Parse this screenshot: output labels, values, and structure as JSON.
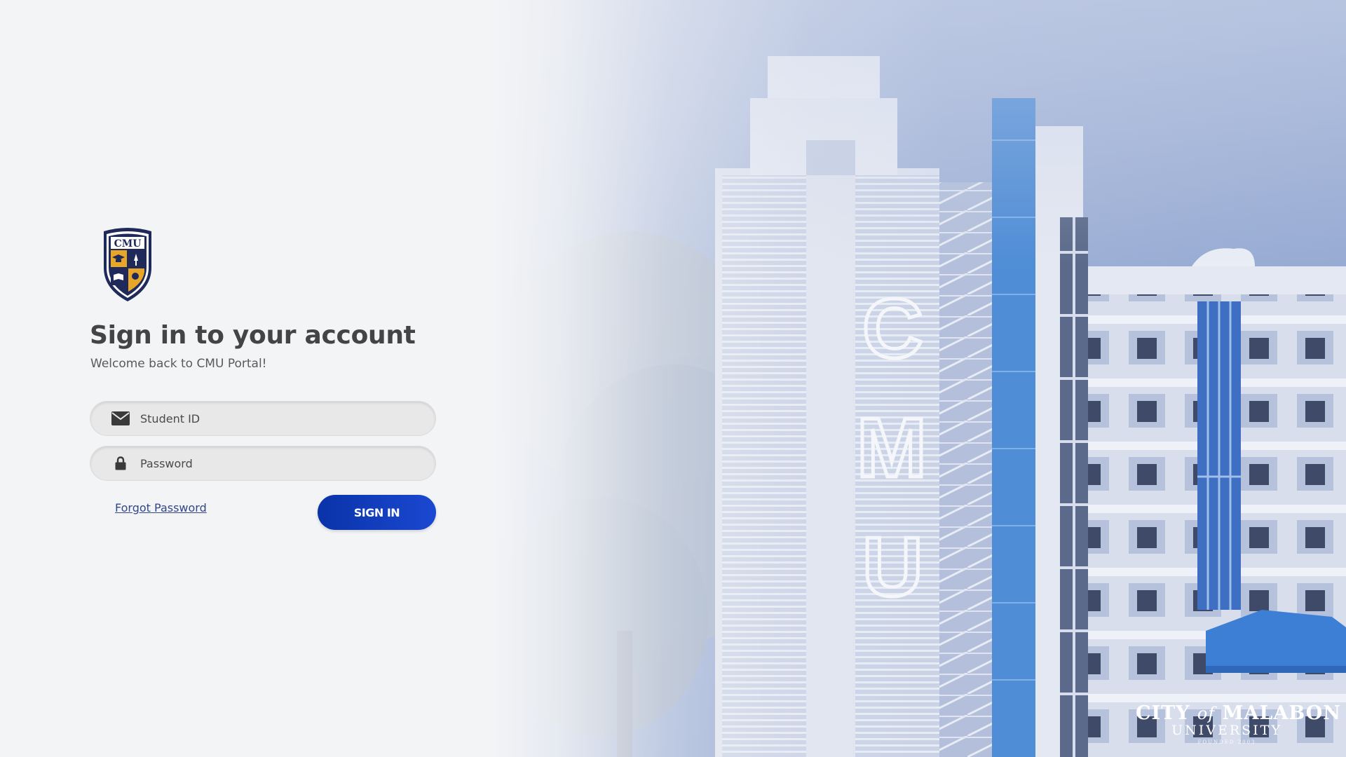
{
  "page": {
    "title": "Sign in to your account",
    "subtitle": "Welcome back to CMU Portal!"
  },
  "logo": {
    "text": "CMU",
    "colors": {
      "navy": "#1f2a5a",
      "gold": "#e8a628",
      "white": "#ffffff"
    }
  },
  "form": {
    "student_id": {
      "placeholder": "Student ID",
      "value": "",
      "icon": "envelope-icon"
    },
    "password": {
      "placeholder": "Password",
      "value": "",
      "icon": "lock-icon"
    },
    "forgot_label": "Forgot Password",
    "submit_label": "SIGN IN"
  },
  "brand": {
    "city": "CITY",
    "of": "of",
    "malabon": "MALABON",
    "university": "UNIVERSITY",
    "founded": "FOUNDED 2003"
  },
  "building_letters": [
    "C",
    "M",
    "U"
  ],
  "colors": {
    "accent": "#0a33a8",
    "background": "#f3f4f6",
    "link": "#33468a",
    "photo_tint": "#8ea2cf",
    "building_stripe": "#4f8dd6"
  }
}
